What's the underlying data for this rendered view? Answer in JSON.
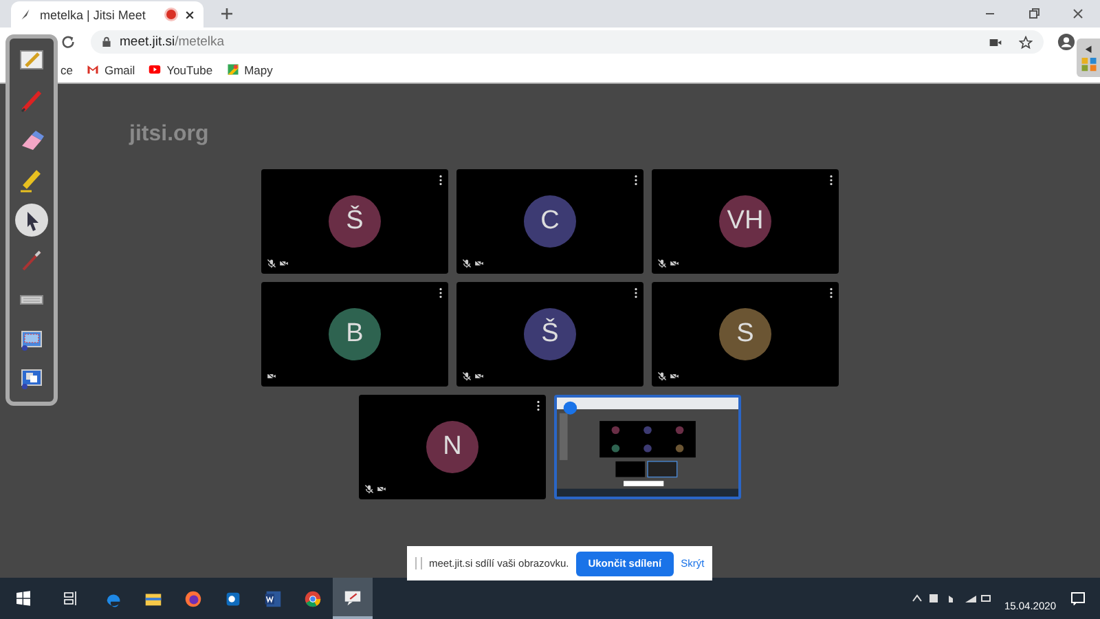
{
  "browser": {
    "tab": {
      "title": "metelka | Jitsi Meet",
      "recording": true
    },
    "url": {
      "host": "meet.jit.si",
      "path": "/metelka"
    },
    "bookmarks": [
      {
        "kind": "apps",
        "label": "ce"
      },
      {
        "kind": "gmail",
        "label": "Gmail"
      },
      {
        "kind": "youtube",
        "label": "YouTube"
      },
      {
        "kind": "maps",
        "label": "Mapy"
      }
    ]
  },
  "meeting": {
    "logo": "jitsi.org",
    "tiles": [
      {
        "kind": "avatar",
        "initials": "Š",
        "color": "#6a2e46",
        "mic_muted": true
      },
      {
        "kind": "avatar",
        "initials": "C",
        "color": "#3d3b73",
        "mic_muted": true
      },
      {
        "kind": "avatar",
        "initials": "VH",
        "color": "#6a2e46",
        "mic_muted": true
      },
      {
        "kind": "avatar",
        "initials": "B",
        "color": "#2e6350",
        "mic_muted": false
      },
      {
        "kind": "avatar",
        "initials": "Š",
        "color": "#3d3b73",
        "mic_muted": true
      },
      {
        "kind": "avatar",
        "initials": "S",
        "color": "#6b5533",
        "mic_muted": true
      },
      {
        "kind": "avatar",
        "initials": "N",
        "color": "#6a2e46",
        "mic_muted": true
      },
      {
        "kind": "screen"
      }
    ]
  },
  "share_bar": {
    "message": "meet.jit.si sdílí vaši obrazovku.",
    "stop": "Ukončit sdílení",
    "hide": "Skrýt"
  },
  "tools": [
    {
      "kind": "board",
      "selected": false
    },
    {
      "kind": "pen",
      "selected": false
    },
    {
      "kind": "eraser",
      "selected": false
    },
    {
      "kind": "highlighter",
      "selected": false
    },
    {
      "kind": "pointer",
      "selected": true
    },
    {
      "kind": "laser",
      "selected": false
    },
    {
      "kind": "keyboard",
      "selected": false
    },
    {
      "kind": "capture",
      "selected": false
    },
    {
      "kind": "screens",
      "selected": false
    }
  ],
  "taskbar": {
    "apps": [
      {
        "kind": "edge",
        "selected": false
      },
      {
        "kind": "explorer",
        "selected": false
      },
      {
        "kind": "firefox",
        "selected": false
      },
      {
        "kind": "outlook",
        "selected": false
      },
      {
        "kind": "word",
        "selected": false
      },
      {
        "kind": "chrome",
        "selected": false
      },
      {
        "kind": "board",
        "selected": true
      }
    ],
    "date": "15.04.2020"
  }
}
